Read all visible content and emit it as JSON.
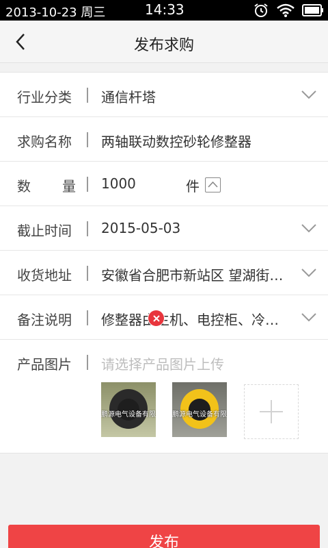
{
  "status_bar": {
    "date": "2013-10-23 周三",
    "time": "14:33",
    "icons": [
      "alarm-icon",
      "wifi-icon",
      "battery-icon"
    ]
  },
  "nav": {
    "title": "发布求购",
    "back_icon": "back-arrow-icon"
  },
  "form": {
    "rows": [
      {
        "label": "行业分类",
        "value": "通信杆塔",
        "icon": "chevron-down-icon"
      },
      {
        "label": "求购名称",
        "value": "两轴联动数控砂轮修整器"
      },
      {
        "label": "数量",
        "label_chars": [
          "数",
          "量"
        ],
        "value": "1000",
        "unit": "件",
        "icon": "chevron-up-icon"
      },
      {
        "label": "截止时间",
        "value": "2015-05-03",
        "icon": "chevron-down-icon"
      },
      {
        "label": "收货地址",
        "value": "安徽省合肥市新站区 望湖街…",
        "icon": "chevron-down-icon"
      },
      {
        "label": "备注说明",
        "value": "修整器由主机、电控柜、冷…",
        "icon": "chevron-down-icon"
      }
    ],
    "photos": {
      "label": "产品图片",
      "placeholder": "请选择产品图片上传",
      "items": [
        {
          "name": "product-photo-1",
          "caption": "鹏源电气设备有限公司",
          "ring_color": "#2a2a2a",
          "bg_color": "#a7ad86"
        },
        {
          "name": "product-photo-2",
          "caption": "鹏源电气设备有限公司",
          "ring_color": "#f2c21a",
          "bg_color": "#8a8b83"
        }
      ],
      "remove_icon": "close-icon",
      "add_icon": "plus-icon"
    }
  },
  "submit": {
    "label": "发布"
  },
  "colors": {
    "accent": "#ef4445",
    "status_bar_bg": "#000000",
    "nav_bg": "#f5f5f5",
    "page_bg": "#f2f2f2"
  }
}
